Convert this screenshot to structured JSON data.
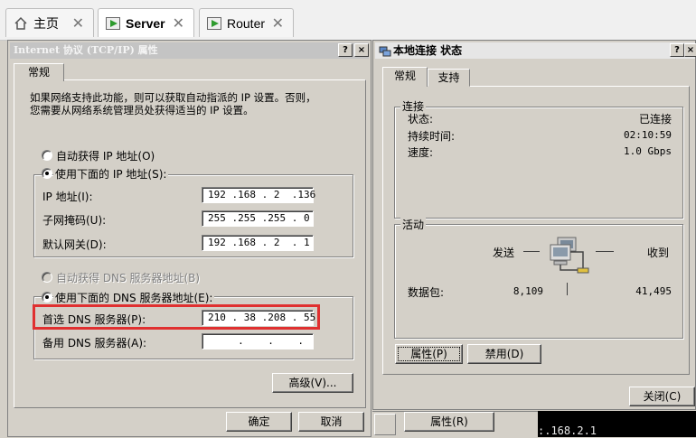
{
  "tabs": [
    {
      "label": "主页",
      "icon": "home-icon"
    },
    {
      "label": "Server",
      "icon": "vm-play-icon"
    },
    {
      "label": "Router",
      "icon": "vm-play-icon"
    }
  ],
  "tcp_dialog": {
    "title": "Internet 协议 (TCP/IP) 属性",
    "help": "?",
    "close": "×",
    "tab": "常规",
    "description": "如果网络支持此功能，则可以获取自动指派的 IP 设置。否则，\n您需要从网络系统管理员处获得适当的 IP 设置。",
    "auto_ip": "自动获得 IP 地址(O)",
    "use_ip": "使用下面的 IP 地址(S):",
    "ip_label": "IP 地址(I):",
    "ip_value": "192 .168 . 2  .136",
    "mask_label": "子网掩码(U):",
    "mask_value": "255 .255 .255 . 0",
    "gateway_label": "默认网关(D):",
    "gateway_value": "192 .168 . 2  . 1",
    "auto_dns": "自动获得 DNS 服务器地址(B)",
    "use_dns": "使用下面的 DNS 服务器地址(E):",
    "dns1_label": "首选 DNS 服务器(P):",
    "dns1_value": "210 . 38 .208 . 55",
    "dns2_label": "备用 DNS 服务器(A):",
    "dns2_value": "     .    .    .",
    "advanced": "高级(V)...",
    "ok": "确定",
    "cancel": "取消"
  },
  "status_dialog": {
    "title": "本地连接 状态",
    "help": "?",
    "close": "×",
    "tabs": [
      "常规",
      "支持"
    ],
    "connection_group": "连接",
    "status_label": "状态:",
    "status_value": "已连接",
    "duration_label": "持续时间:",
    "duration_value": "02:10:59",
    "speed_label": "速度:",
    "speed_value": "1.0 Gbps",
    "activity_group": "活动",
    "sent_label": "发送",
    "received_label": "收到",
    "packets_label": "数据包:",
    "packets_sent": "8,109",
    "packets_received": "41,495",
    "properties": "属性(P)",
    "disable": "禁用(D)",
    "close_button": "关闭(C)"
  },
  "background": {
    "properties_button": "属性(R)",
    "console_text": ":.168.2.1"
  }
}
